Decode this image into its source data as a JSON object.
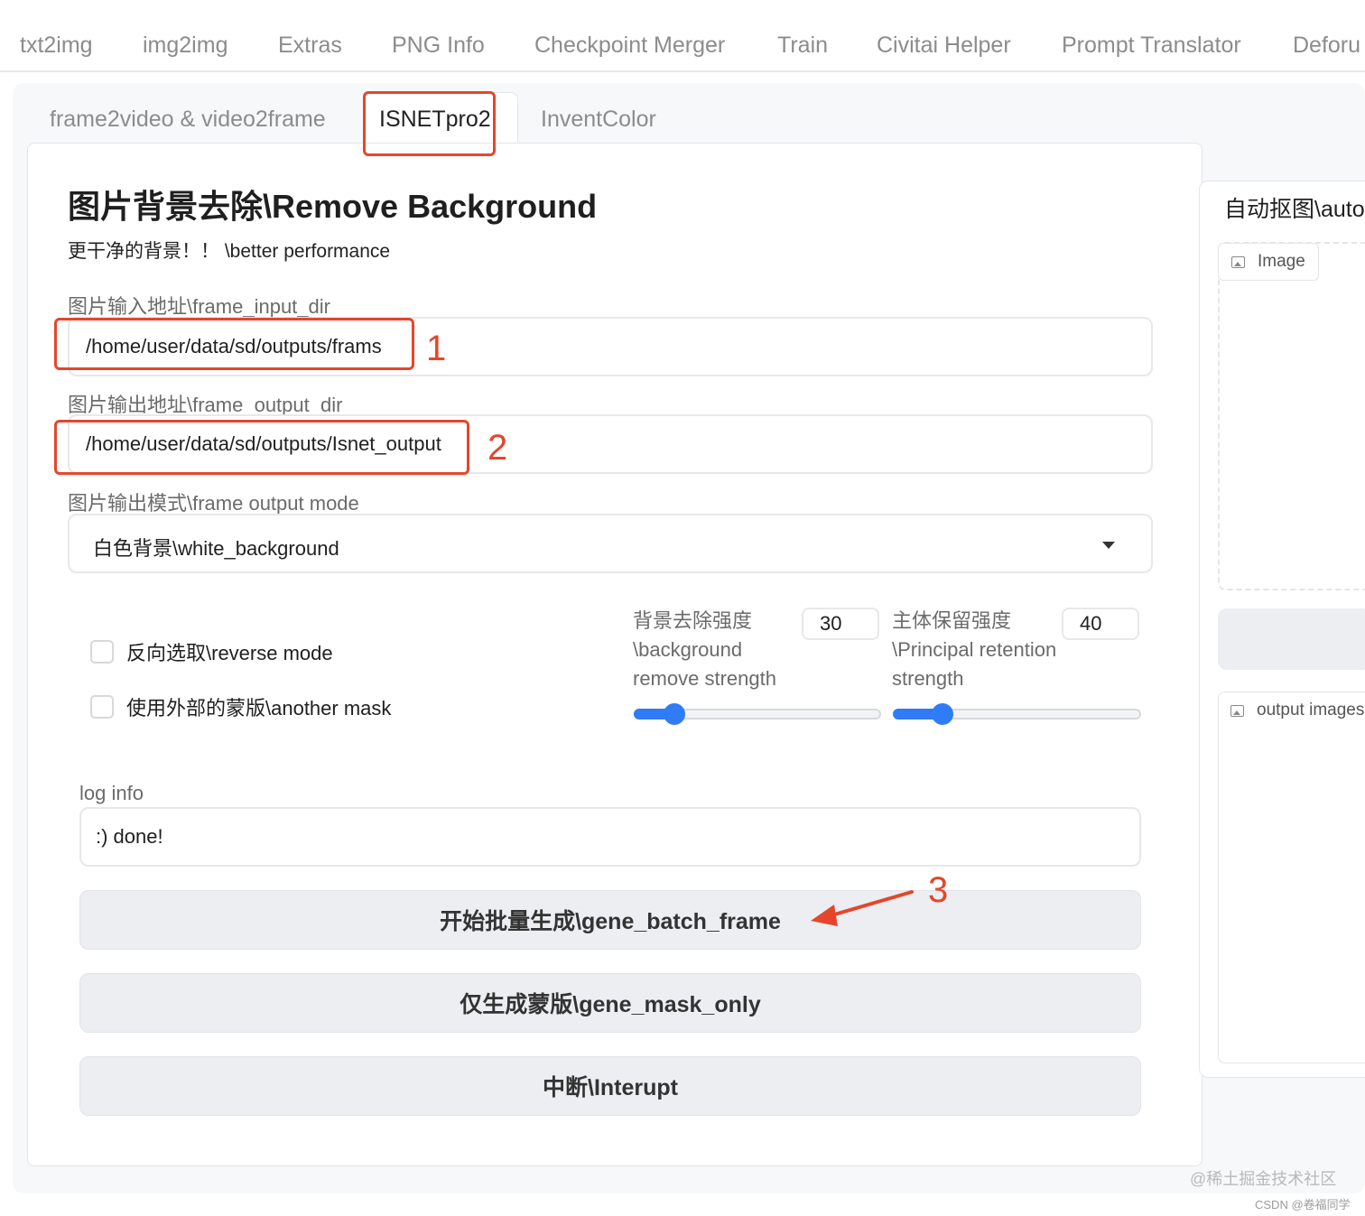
{
  "top_tabs": [
    "txt2img",
    "img2img",
    "Extras",
    "PNG Info",
    "Checkpoint Merger",
    "Train",
    "Civitai Helper",
    "Prompt Translator",
    "Deforu"
  ],
  "sub_tabs": [
    "frame2video & video2frame",
    "ISNETpro2",
    "InventColor"
  ],
  "title": "图片背景去除\\Remove Background",
  "subtitle": "更干净的背景！！ \\better performance",
  "input_dir": {
    "label": "图片输入地址\\frame_input_dir",
    "value": "/home/user/data/sd/outputs/frams"
  },
  "output_dir": {
    "label": "图片输出地址\\frame_output_dir",
    "value": "/home/user/data/sd/outputs/Isnet_output"
  },
  "output_mode": {
    "label": "图片输出模式\\frame output mode",
    "value": "白色背景\\white_background"
  },
  "checkboxes": {
    "reverse": "反向选取\\reverse mode",
    "mask": "使用外部的蒙版\\another mask"
  },
  "slider_bg": {
    "label_line1": "背景去除强度",
    "label_line2": "\\background",
    "label_line3": "remove strength",
    "value": "30",
    "fraction": 0.15
  },
  "slider_principal": {
    "label_line1": "主体保留强度",
    "label_line2": "\\Principal retention",
    "label_line3": "strength",
    "value": "40",
    "fraction": 0.19
  },
  "log": {
    "label": "log info",
    "value": ":) done!"
  },
  "buttons": {
    "gene_batch": "开始批量生成\\gene_batch_frame",
    "gene_mask": "仅生成蒙版\\gene_mask_only",
    "interrupt": "中断\\Interupt"
  },
  "right": {
    "title": "自动抠图\\auto",
    "image_label": "Image",
    "output_label": "output images"
  },
  "annotations": [
    "1",
    "2",
    "3"
  ],
  "watermarks": [
    "@稀土掘金技术社区",
    "CSDN @卷福同学"
  ],
  "colors": {
    "accent": "#2f7cf6",
    "annotation_red": "#e5462b"
  }
}
